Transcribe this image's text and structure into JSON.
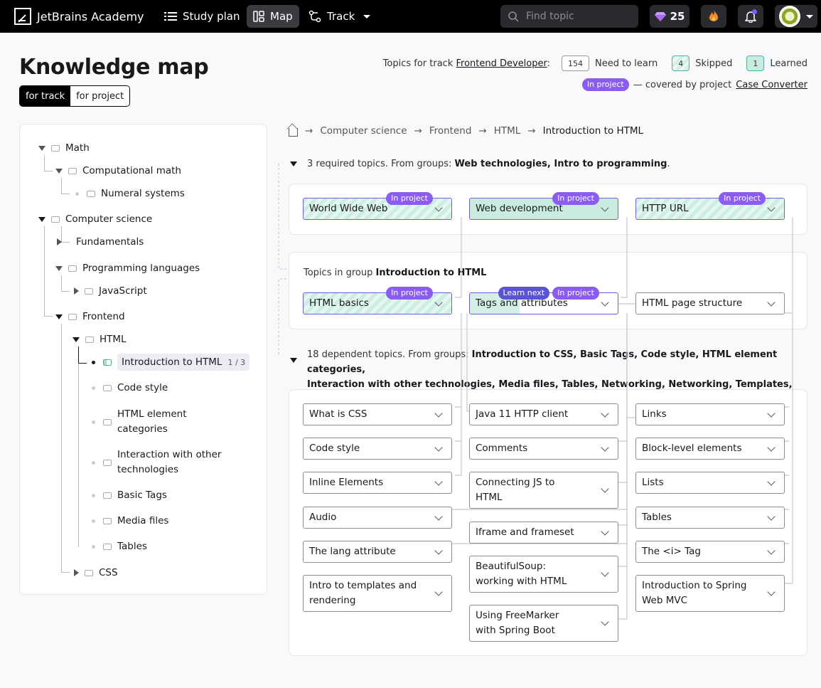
{
  "header": {
    "logo_text": "JetBrains Academy",
    "nav": [
      {
        "label": "Study plan",
        "icon": "list-icon"
      },
      {
        "label": "Map",
        "icon": "map-icon",
        "active": true
      },
      {
        "label": "Track",
        "icon": "track-icon"
      }
    ],
    "search_placeholder": "Find topic",
    "gems": "25",
    "colors": {
      "bar": "#000000",
      "accent": "#8a5cf0",
      "learned": "#c9ecdf"
    }
  },
  "page": {
    "title": "Knowledge map",
    "toggle": {
      "track": "for track",
      "project": "for project"
    },
    "stats": {
      "prefix": "Topics for track",
      "track_name": "Frontend Developer",
      "colon": ":",
      "need_count": "154",
      "need_label": "Need to learn",
      "skipped_count": "4",
      "skipped_label": "Skipped",
      "learned_count": "1",
      "learned_label": "Learned"
    },
    "legend": {
      "badge": "In project",
      "text": "— covered by project",
      "project": "Case Converter"
    }
  },
  "tree": {
    "math": "Math",
    "computational_math": "Computational math",
    "numeral_systems": "Numeral systems",
    "computer_science": "Computer science",
    "fundamentals": "Fundamentals",
    "programming_languages": "Programming languages",
    "javascript": "JavaScript",
    "frontend": "Frontend",
    "html": "HTML",
    "intro_html": "Introduction to HTML",
    "intro_progress": "1 / 3",
    "code_style": "Code style",
    "html_categories_1": "HTML element",
    "html_categories_2": "categories",
    "interaction_1": "Interaction with other",
    "interaction_2": "technologies",
    "basic_tags": "Basic Tags",
    "media_files": "Media files",
    "tables": "Tables",
    "css": "CSS"
  },
  "breadcrumb": {
    "items": [
      "Computer science",
      "Frontend",
      "HTML"
    ],
    "current": "Introduction to HTML",
    "sep": "→"
  },
  "required": {
    "text": "3 required topics. From groups:",
    "groups": "Web technologies, Intro to programming",
    "dot": ".",
    "topics": [
      "World Wide Web",
      "Web development",
      "HTTP URL"
    ],
    "badge": "In project"
  },
  "group": {
    "prefix": "Topics in group",
    "name": "Introduction to HTML",
    "topics": [
      "HTML basics",
      "Tags and attributes",
      "HTML page structure"
    ],
    "learn_next": "Learn next",
    "badge": "In project"
  },
  "dependent": {
    "text": "18 dependent topics. From groups:",
    "groups_line1": "Introduction to CSS, Basic Tags, Code style, HTML element categories,",
    "groups_line2": "Interaction with other technologies, Media files, Tables, Networking, Networking, Templates, Web",
    "dot": ".",
    "col1": [
      "What is CSS",
      "Code style",
      "Inline Elements",
      "Audio",
      "The lang attribute",
      [
        "Intro to templates and",
        "rendering"
      ]
    ],
    "col2": [
      "Java 11 HTTP client",
      "Comments",
      [
        "Connecting JS to",
        "HTML"
      ],
      "Iframe and frameset",
      [
        "BeautifulSoup:",
        "working with HTML"
      ],
      [
        "Using FreeMarker",
        "with Spring Boot"
      ]
    ],
    "col3": [
      "Links",
      "Block-level elements",
      "Lists",
      "Tables",
      "The <i> Tag",
      [
        "Introduction to Spring",
        "Web MVC"
      ]
    ]
  }
}
